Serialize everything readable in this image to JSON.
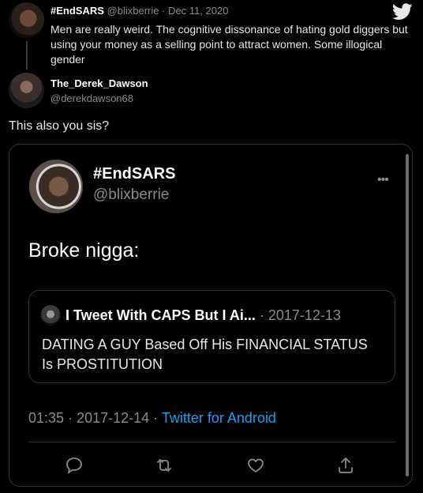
{
  "tweet1": {
    "display_name": "#EndSARS",
    "handle": "@blixberrie",
    "date": "· Dec 11, 2020",
    "text": "Men are really weird. The cognitive dissonance of hating gold diggers but using your money as a selling point to attract women. Some illogical gender"
  },
  "tweet2": {
    "display_name": "The_Derek_Dawson",
    "handle": "@derekdawson68",
    "reply": "This also you sis?"
  },
  "screenshot_tweet": {
    "display_name": "#EndSARS",
    "handle": "@blixberrie",
    "text": "Broke nigga:",
    "quote": {
      "display_name": "I Tweet With CAPS But I Ai...",
      "date": "· 2017-12-13",
      "text": "DATING A GUY Based Off His FINANCIAL STATUS Is PROSTITUTION"
    },
    "meta": {
      "time": "01:35",
      "date": "· 2017-12-14 ·",
      "source": "Twitter for Android"
    }
  },
  "icons": {
    "brand": "twitter-bird-icon",
    "more": "more-dots-icon",
    "reply": "reply-bubble-icon",
    "retweet": "retweet-icon",
    "like": "heart-icon",
    "share": "share-icon"
  },
  "colors": {
    "background": "#000000",
    "link": "#1d9bf0",
    "muted": "#8b8b8b",
    "border": "#2f3336"
  }
}
